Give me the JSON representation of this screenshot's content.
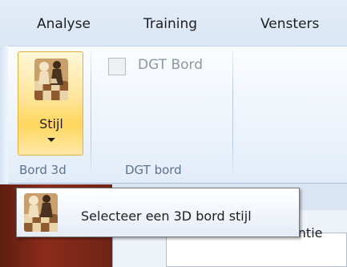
{
  "menu": {
    "tabs": [
      {
        "label": "Analyse"
      },
      {
        "label": "Training"
      },
      {
        "label": "Vensters"
      }
    ]
  },
  "ribbon": {
    "style_button": {
      "label": "Stijl",
      "icon": "chess-pieces-icon"
    },
    "dgt_checkbox": {
      "label": "DGT Bord",
      "checked": false,
      "enabled": false
    },
    "groups": [
      {
        "label": "Bord 3d"
      },
      {
        "label": "DGT bord"
      }
    ]
  },
  "tooltip": {
    "text": "Selecteer een 3D bord stijl",
    "icon": "chess-pieces-icon"
  },
  "background_panel": {
    "partial_text": "Referentie"
  },
  "colors": {
    "ribbon_bg": "#eef4fb",
    "hot_button": "#ffd65e",
    "tooltip_border": "#767676"
  }
}
